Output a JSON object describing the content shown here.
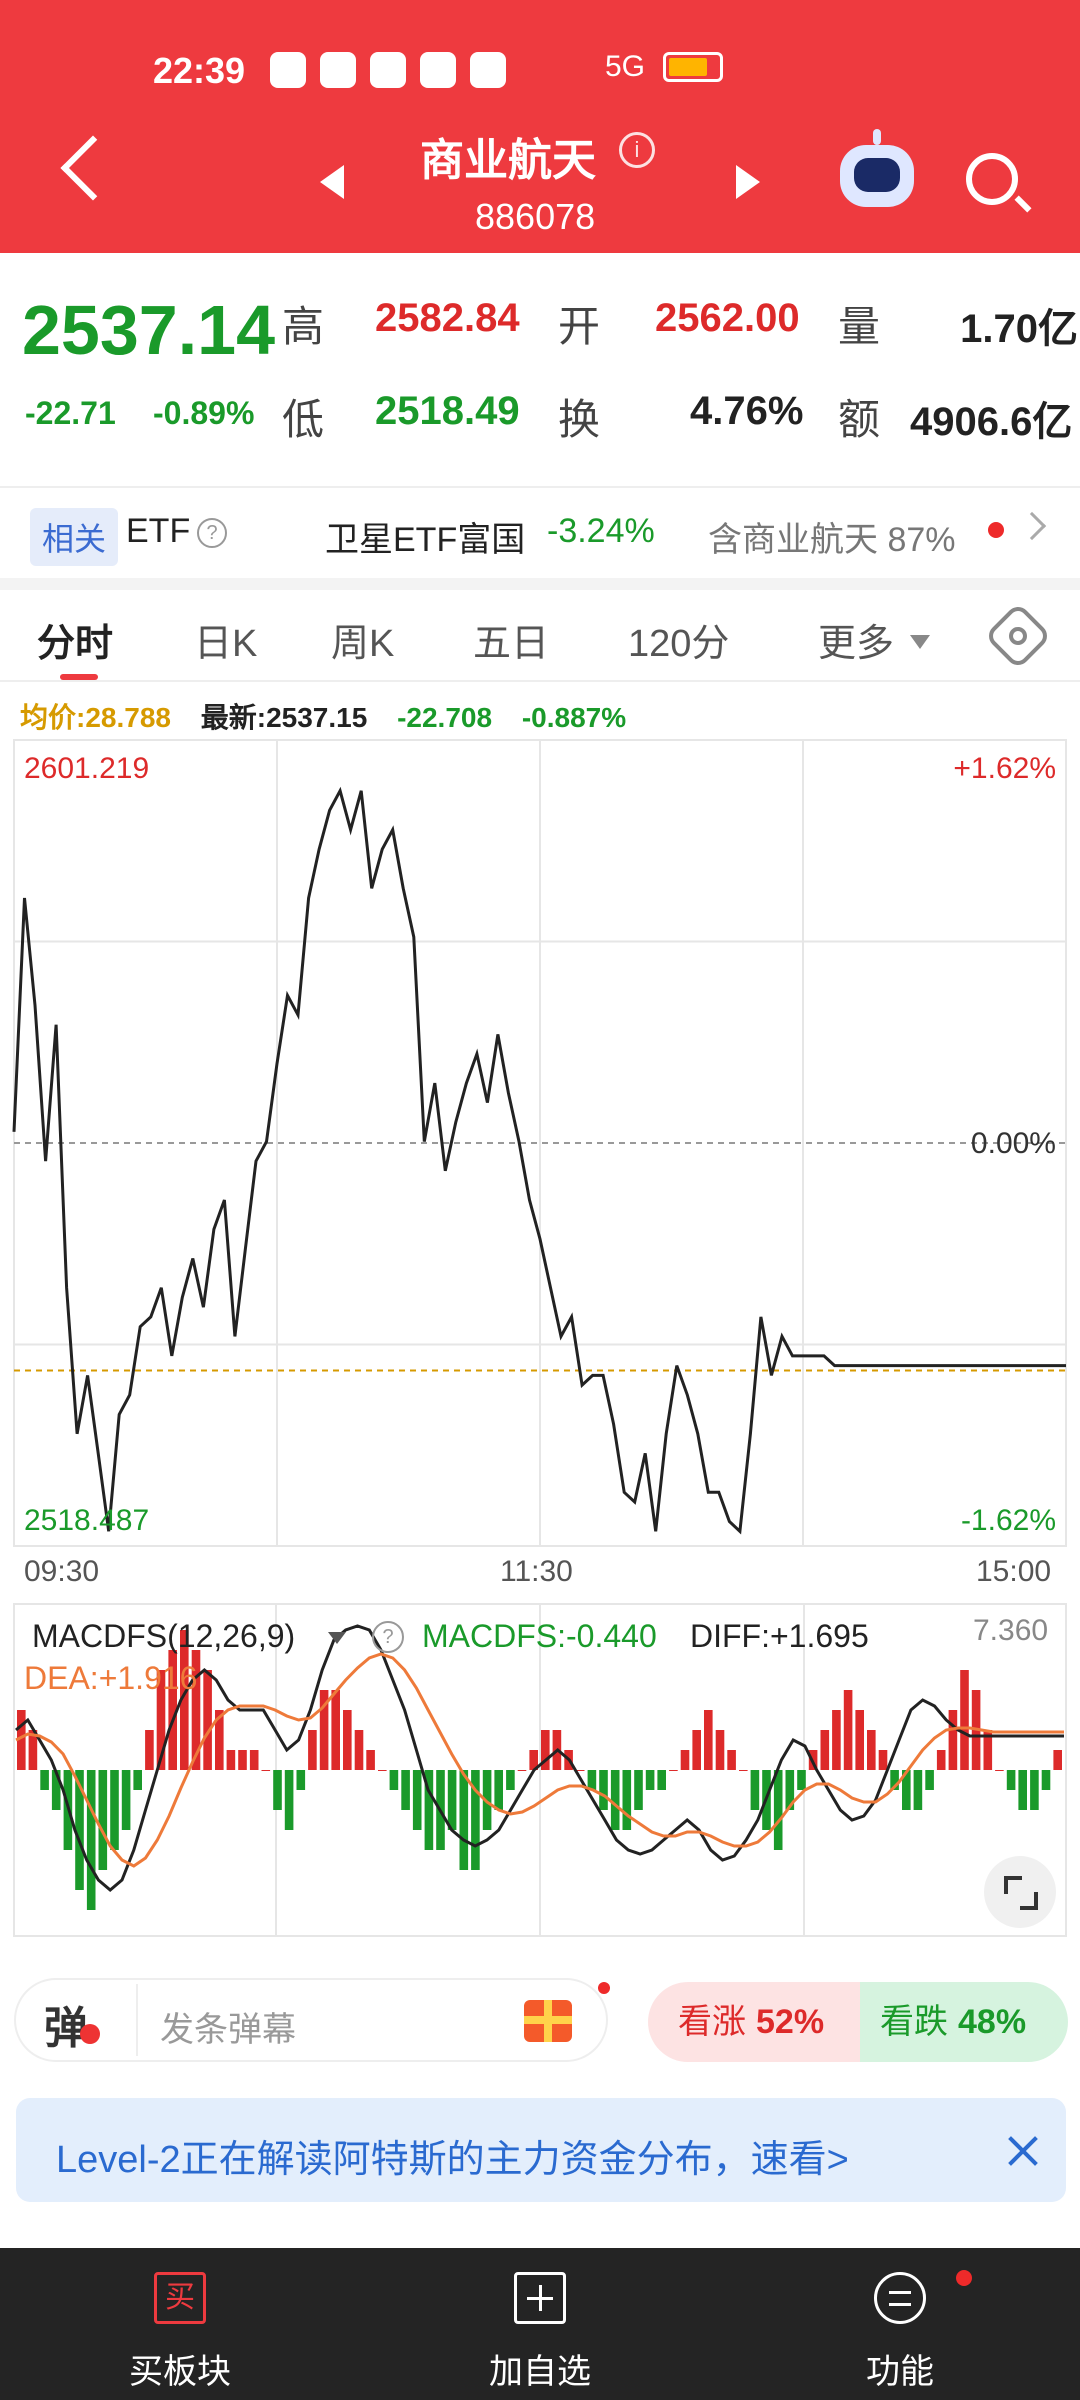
{
  "status_bar": {
    "time": "22:39",
    "network": "5G"
  },
  "header": {
    "title": "商业航天",
    "code": "886078",
    "colors": {
      "background": "#ee3a3f"
    }
  },
  "quote": {
    "price": "2537.14",
    "change": "-22.71",
    "change_pct": "-0.89%",
    "high_label": "高",
    "high": "2582.84",
    "low_label": "低",
    "low": "2518.49",
    "open_label": "开",
    "open": "2562.00",
    "turnover_label": "换",
    "turnover": "4.76%",
    "volume_label": "量",
    "volume": "1.70亿",
    "amount_label": "额",
    "amount": "4906.6亿"
  },
  "etf": {
    "tag": "相关",
    "label": "ETF",
    "help_icon": "?",
    "name": "卫星ETF富国",
    "pct": "-3.24%",
    "contains": "含商业航天 87%"
  },
  "tabs": [
    "分时",
    "日K",
    "周K",
    "五日",
    "120分",
    "更多"
  ],
  "info_row": {
    "avg": "均价:28.788",
    "latest": "最新:2537.15",
    "change": "-22.708",
    "change_pct": "-0.887%"
  },
  "chart_data": [
    {
      "type": "line",
      "y_top_label": "2601.219",
      "y_bottom_label": "2518.487",
      "right_top_label": "+1.62%",
      "right_mid_label": "0.00%",
      "right_bottom_label": "-1.62%",
      "x_labels": [
        "09:30",
        "11:30",
        "15:00"
      ],
      "ylim": [
        2518.487,
        2601.219
      ],
      "pre_close": 2559.85,
      "avg_line": 2536.5,
      "series": [
        {
          "name": "",
          "x": [
            0,
            0.01,
            0.02,
            0.03,
            0.04,
            0.05,
            0.06,
            0.07,
            0.08,
            0.09,
            0.1,
            0.11,
            0.12,
            0.13,
            0.14,
            0.15,
            0.16,
            0.17,
            0.18,
            0.19,
            0.2,
            0.21,
            0.22,
            0.23,
            0.24,
            0.25,
            0.26,
            0.27,
            0.28,
            0.29,
            0.3,
            0.31,
            0.32,
            0.33,
            0.34,
            0.35,
            0.36,
            0.37,
            0.38,
            0.39,
            0.4,
            0.41,
            0.42,
            0.43,
            0.44,
            0.45,
            0.46,
            0.47,
            0.48,
            0.49,
            0.5,
            0.51,
            0.52,
            0.53,
            0.54,
            0.55,
            0.56,
            0.57,
            0.58,
            0.59,
            0.6,
            0.61,
            0.62,
            0.63,
            0.64,
            0.65,
            0.66,
            0.67,
            0.68,
            0.69,
            0.7,
            0.71,
            0.72,
            0.73,
            0.74,
            0.75,
            0.76,
            0.77,
            0.78,
            0.79,
            0.8,
            0.81,
            0.82,
            0.83,
            0.84,
            0.85,
            0.86,
            0.87,
            0.88,
            0.89,
            0.9,
            0.91,
            0.92,
            0.93,
            0.94,
            0.95,
            0.96,
            0.97,
            0.98,
            0.99,
            1.0
          ],
          "values": [
            2561,
            2585,
            2574,
            2558,
            2572,
            2545,
            2530,
            2536,
            2528,
            2520,
            2532,
            2534,
            2541,
            2542,
            2545,
            2538,
            2544,
            2548,
            2543,
            2551,
            2554,
            2540,
            2549,
            2558,
            2560,
            2568,
            2575,
            2573,
            2585,
            2590,
            2594,
            2596,
            2592,
            2596,
            2586,
            2590,
            2592,
            2586,
            2581,
            2560,
            2566,
            2557,
            2562,
            2566,
            2569,
            2564,
            2571,
            2565,
            2560,
            2554,
            2550,
            2545,
            2540,
            2542,
            2535,
            2536,
            2536,
            2531,
            2524,
            2523,
            2528,
            2520,
            2530,
            2537,
            2534,
            2530,
            2524,
            2524,
            2521,
            2520,
            2530,
            2542,
            2536,
            2540,
            2538,
            2538,
            2538,
            2538,
            2537,
            2537,
            2537,
            2537,
            2537,
            2537,
            2537,
            2537,
            2537,
            2537,
            2537,
            2537,
            2537,
            2537,
            2537,
            2537,
            2537,
            2537,
            2537,
            2537,
            2537,
            2537,
            2537
          ]
        }
      ]
    },
    {
      "type": "bar",
      "label": "MACDFS(12,26,9)",
      "macd_label": "MACDFS:-0.440",
      "diff_label": "DIFF:+1.695",
      "dea_label": "DEA:+1.916",
      "max_label": "7.360",
      "values": [
        3,
        2,
        -1,
        -2,
        -4,
        -6,
        -7,
        -5,
        -4,
        -3,
        -1,
        2,
        5,
        6,
        7,
        6,
        5,
        3,
        1,
        1,
        1,
        0,
        -2,
        -3,
        -1,
        2,
        4,
        4,
        3,
        2,
        1,
        0,
        -1,
        -2,
        -3,
        -4,
        -4,
        -3,
        -5,
        -5,
        -3,
        -2,
        -1,
        0,
        1,
        2,
        2,
        1,
        0,
        -1,
        -2,
        -3,
        -3,
        -2,
        -1,
        -1,
        0,
        1,
        2,
        3,
        2,
        1,
        0,
        -2,
        -3,
        -4,
        -2,
        -1,
        1,
        2,
        3,
        4,
        3,
        2,
        1,
        -1,
        -2,
        -2,
        -1,
        1,
        3,
        5,
        4,
        2,
        0,
        -1,
        -2,
        -2,
        -1,
        1
      ],
      "diff": [
        2,
        2.5,
        1.5,
        0.5,
        -1,
        -3,
        -4.5,
        -5.5,
        -6,
        -5.5,
        -4,
        -2,
        0,
        2,
        3.5,
        4.5,
        5,
        4.5,
        3.5,
        3,
        3,
        3,
        2,
        1,
        1.5,
        3,
        5,
        6.5,
        7,
        7.2,
        7,
        6,
        4.5,
        3,
        1,
        -1,
        -2,
        -3,
        -3.5,
        -3.8,
        -3.5,
        -3,
        -2,
        -1,
        0,
        0.5,
        1,
        0.5,
        -0.5,
        -1.5,
        -2.5,
        -3.5,
        -4,
        -4.2,
        -4,
        -3.5,
        -3,
        -2.5,
        -3,
        -4,
        -4.5,
        -4.3,
        -3.5,
        -2.5,
        -1,
        0.5,
        1.5,
        1.2,
        0,
        -1,
        -2,
        -2.5,
        -2.3,
        -1.5,
        0,
        1.5,
        3,
        3.5,
        3.2,
        2.5,
        2,
        1.7,
        1.7,
        1.7,
        1.7,
        1.7,
        1.7,
        1.7,
        1.7,
        1.7
      ],
      "dea": [
        1.5,
        1.8,
        1.7,
        1.4,
        0.8,
        -0.3,
        -1.5,
        -2.7,
        -3.8,
        -4.5,
        -4.8,
        -4.4,
        -3.5,
        -2.3,
        -0.9,
        0.4,
        1.6,
        2.5,
        3,
        3.2,
        3.2,
        3.2,
        3,
        2.7,
        2.5,
        2.6,
        3.1,
        3.8,
        4.5,
        5.1,
        5.6,
        5.8,
        5.6,
        5,
        4.1,
        3,
        1.9,
        0.8,
        -0.2,
        -1,
        -1.6,
        -2,
        -2.2,
        -2.1,
        -1.8,
        -1.4,
        -1,
        -0.8,
        -0.8,
        -1,
        -1.3,
        -1.8,
        -2.3,
        -2.7,
        -3.1,
        -3.3,
        -3.3,
        -3.1,
        -3.1,
        -3.3,
        -3.6,
        -3.8,
        -3.8,
        -3.6,
        -3.1,
        -2.4,
        -1.6,
        -1,
        -0.7,
        -0.7,
        -1,
        -1.4,
        -1.6,
        -1.6,
        -1.2,
        -0.6,
        0.2,
        1,
        1.6,
        2,
        2.1,
        2.1,
        2,
        1.9,
        1.9,
        1.9,
        1.9,
        1.9,
        1.9,
        1.9
      ]
    }
  ],
  "danmu": {
    "label": "弹",
    "placeholder": "发条弹幕",
    "bull_label": "看涨",
    "bull_pct": "52%",
    "bear_label": "看跌",
    "bear_pct": "48%"
  },
  "banner": {
    "text": "Level-2正在解读阿特斯的主力资金分布，速看>"
  },
  "bottom_nav": {
    "buy_icon": "买",
    "buy_label": "买板块",
    "add_label": "加自选",
    "menu_label": "功能"
  },
  "colors": {
    "up": "#dd2a2a",
    "down": "#1a9a2a",
    "avg": "#d69a00",
    "dea": "#ee7a3a"
  }
}
